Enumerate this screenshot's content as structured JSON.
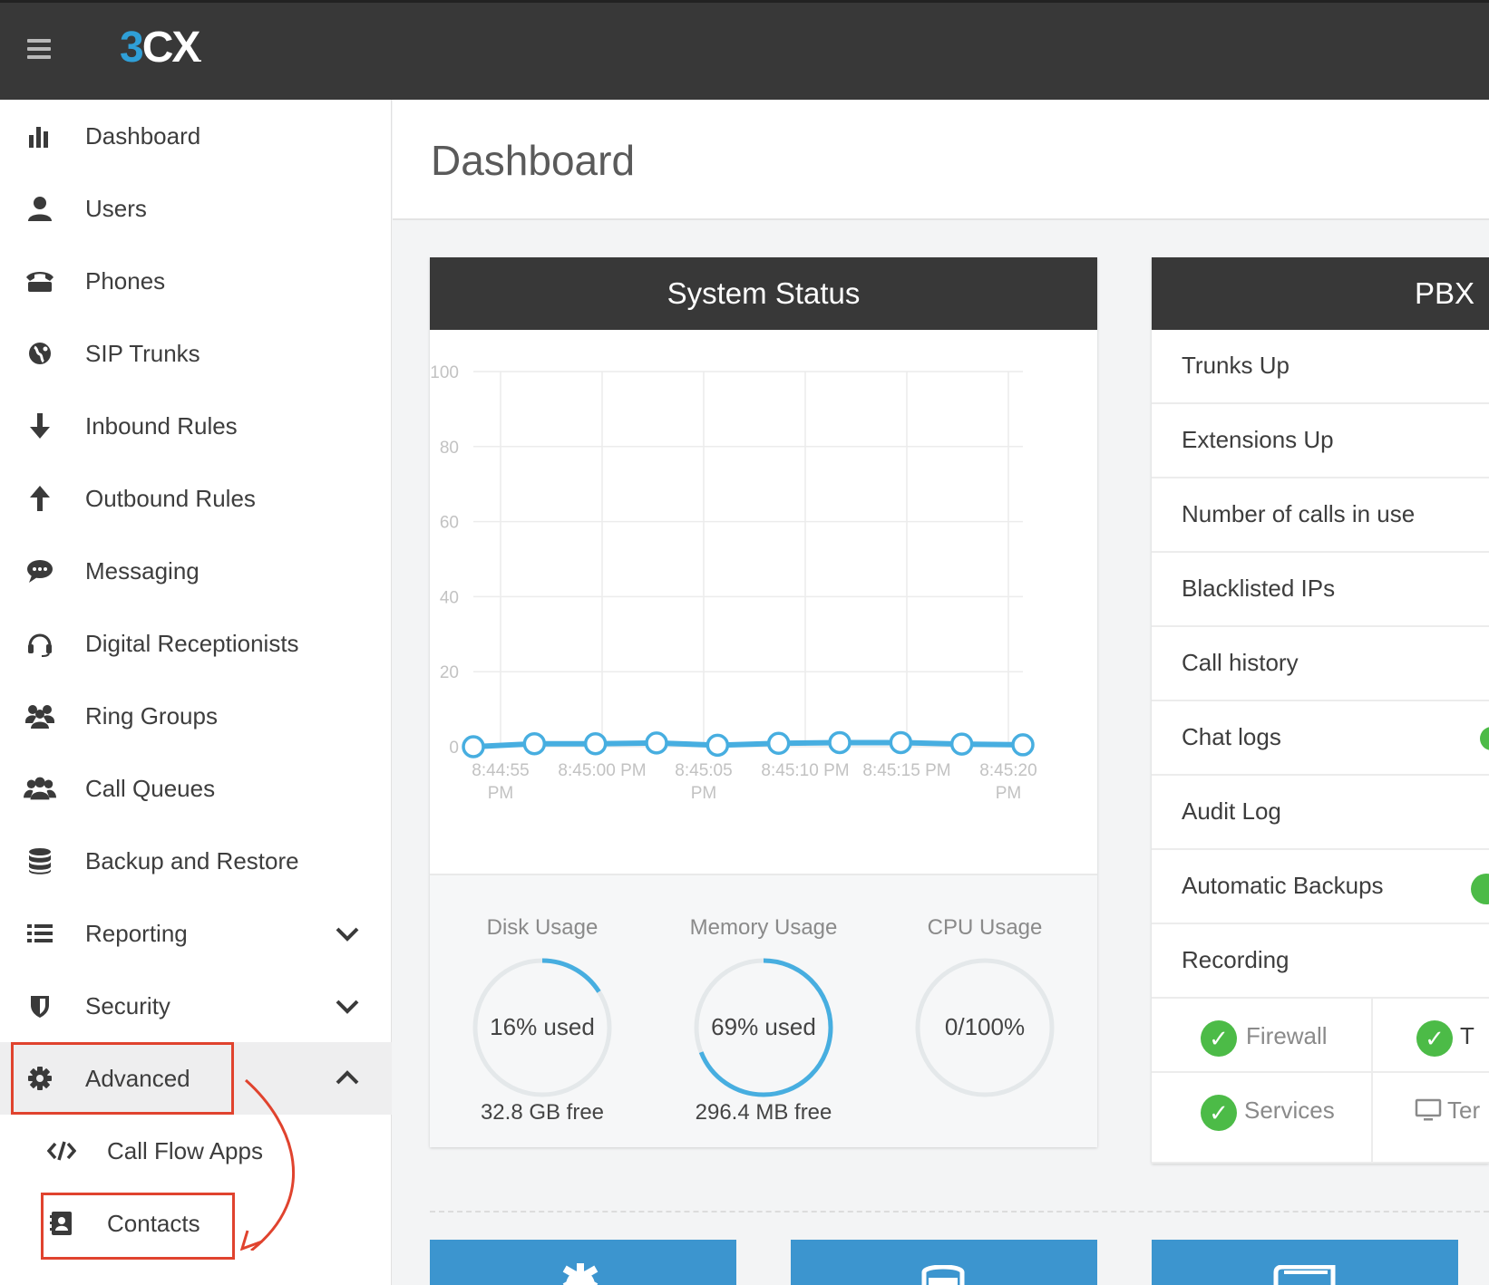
{
  "app": {
    "logo_3": "3",
    "logo_cx": "CX",
    "logo_mark": "."
  },
  "sidebar": {
    "items": [
      {
        "label": "Dashboard",
        "icon": "bar-chart-icon"
      },
      {
        "label": "Users",
        "icon": "user-icon"
      },
      {
        "label": "Phones",
        "icon": "phone-icon"
      },
      {
        "label": "SIP Trunks",
        "icon": "globe-icon"
      },
      {
        "label": "Inbound Rules",
        "icon": "arrow-down-icon"
      },
      {
        "label": "Outbound Rules",
        "icon": "arrow-up-icon"
      },
      {
        "label": "Messaging",
        "icon": "chat-bubble-icon"
      },
      {
        "label": "Digital Receptionists",
        "icon": "headset-icon"
      },
      {
        "label": "Ring Groups",
        "icon": "group-icon"
      },
      {
        "label": "Call Queues",
        "icon": "users-icon"
      },
      {
        "label": "Backup and Restore",
        "icon": "database-icon"
      },
      {
        "label": "Reporting",
        "icon": "list-icon"
      },
      {
        "label": "Security",
        "icon": "shield-icon"
      },
      {
        "label": "Advanced",
        "icon": "gear-icon"
      },
      {
        "label": "Call Flow Apps",
        "icon": "code-icon"
      },
      {
        "label": "Contacts",
        "icon": "contact-book-icon"
      }
    ]
  },
  "page": {
    "title": "Dashboard"
  },
  "system_status": {
    "title": "System Status",
    "gauges": [
      {
        "title": "Disk Usage",
        "value": "16% used",
        "sub": "32.8 GB free",
        "percent": 16
      },
      {
        "title": "Memory Usage",
        "value": "69% used",
        "sub": "296.4 MB free",
        "percent": 69
      },
      {
        "title": "CPU Usage",
        "value": "0/100%",
        "sub": "",
        "percent": 0
      }
    ]
  },
  "pbx_status": {
    "title": "PBX S",
    "rows": [
      "Trunks Up",
      "Extensions Up",
      "Number of calls in use",
      "Blacklisted IPs",
      "Call history",
      "Chat logs",
      "Audit Log",
      "Automatic Backups",
      "Recording"
    ],
    "checks": [
      {
        "label": "Firewall",
        "mark": "✓"
      },
      {
        "label": "T",
        "mark": "✓"
      },
      {
        "label": "Services",
        "mark": "✓"
      },
      {
        "label": "Ter",
        "mark": ""
      }
    ]
  },
  "colors": {
    "topbar": "#383838",
    "accent": "#2f9fd7",
    "highlight": "#e0432e",
    "ok": "#4cbb47",
    "tile": "#3c95cf"
  },
  "chart_data": {
    "type": "line",
    "title": "",
    "xlabel": "",
    "ylabel": "",
    "ylim": [
      0,
      100
    ],
    "yticks": [
      0,
      20,
      40,
      60,
      80,
      100
    ],
    "xtick_labels": [
      [
        "8:44:55",
        "PM"
      ],
      [
        "8:45:00 PM",
        ""
      ],
      [
        "8:45:05",
        "PM"
      ],
      [
        "8:45:10 PM",
        ""
      ],
      [
        "8:45:15 PM",
        ""
      ],
      [
        "8:45:20",
        "PM"
      ]
    ],
    "grid": true,
    "series": [
      {
        "values": [
          0,
          0.8,
          0.8,
          1,
          0.4,
          0.9,
          1.1,
          1.1,
          0.7,
          0.5
        ]
      }
    ]
  }
}
